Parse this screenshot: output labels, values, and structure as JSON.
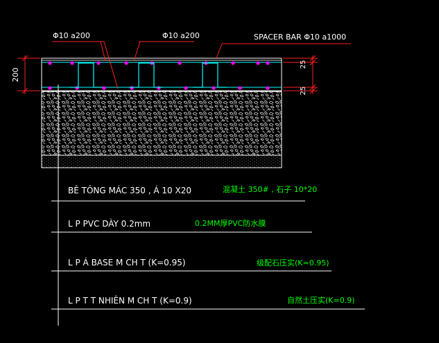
{
  "colors": {
    "background": "#000000",
    "rebar_line": "#00ffff",
    "rebar_dot": "#ff00ff",
    "leader_red": "#ff2020",
    "text_white": "#ffffff",
    "text_green": "#00ff00",
    "text_yellow": "#ffff00",
    "layer_line": "#ffffff"
  },
  "top_labels": {
    "rebar_left": "Φ10 a200",
    "rebar_mid": "Φ10 a200",
    "spacer": "SPACER BAR  Φ10 a1000"
  },
  "dimensions": {
    "total_thickness": "200",
    "cover_top": "25",
    "cover_bottom": "25"
  },
  "layers": [
    {
      "vn": "BÊ TÔNG MÁC 350 ,  Á 10 X20",
      "cn": "混凝土 350# , 石子 10*20"
    },
    {
      "vn": "L  P PVC DÀY  0.2mm",
      "cn": "0.2MM厚PVC防水膜"
    },
    {
      "vn": "L  P   Á BASE    M CH  T (K=0.95)",
      "cn": "级配石压实(K=0.95)"
    },
    {
      "vn": "L  P    T   T  NHIÊN    M CH  T (K=0.9)",
      "cn": "自然土压实(K=0.9)"
    }
  ]
}
